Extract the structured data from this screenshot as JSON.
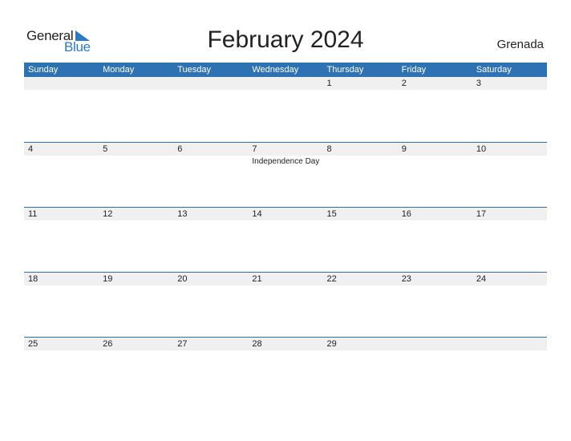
{
  "logo": {
    "general": "General",
    "blue": "Blue"
  },
  "title": "February 2024",
  "country": "Grenada",
  "colors": {
    "header": "#2e72b3",
    "strip": "#f0f0f0",
    "logo_blue": "#2a7bc4"
  },
  "weekdays": [
    "Sunday",
    "Monday",
    "Tuesday",
    "Wednesday",
    "Thursday",
    "Friday",
    "Saturday"
  ],
  "weeks": [
    {
      "days": [
        "",
        "",
        "",
        "",
        "1",
        "2",
        "3"
      ],
      "events": [
        "",
        "",
        "",
        "",
        "",
        "",
        ""
      ]
    },
    {
      "days": [
        "4",
        "5",
        "6",
        "7",
        "8",
        "9",
        "10"
      ],
      "events": [
        "",
        "",
        "",
        "Independence Day",
        "",
        "",
        ""
      ]
    },
    {
      "days": [
        "11",
        "12",
        "13",
        "14",
        "15",
        "16",
        "17"
      ],
      "events": [
        "",
        "",
        "",
        "",
        "",
        "",
        ""
      ]
    },
    {
      "days": [
        "18",
        "19",
        "20",
        "21",
        "22",
        "23",
        "24"
      ],
      "events": [
        "",
        "",
        "",
        "",
        "",
        "",
        ""
      ]
    },
    {
      "days": [
        "25",
        "26",
        "27",
        "28",
        "29",
        "",
        ""
      ],
      "events": [
        "",
        "",
        "",
        "",
        "",
        "",
        ""
      ]
    }
  ]
}
